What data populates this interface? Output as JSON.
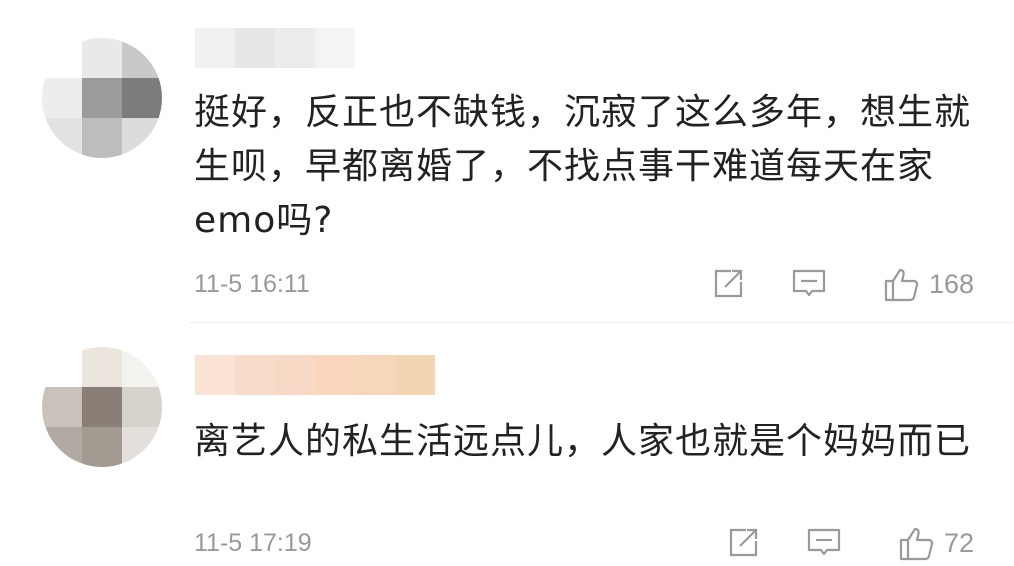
{
  "comments": [
    {
      "text": "挺好，反正也不缺钱，沉寂了这么多年，想生就生呗，早都离婚了，不找点事干难道每天在家emo吗?",
      "time": "11-5 16:11",
      "like_count": "168",
      "avatar_colors": [
        "#ffffff",
        "#e9e9e9",
        "#c9c9c9",
        "#ededed",
        "#9b9b9b",
        "#7c7c7c",
        "#e2e2e2",
        "#bdbdbd",
        "#dcdcdc"
      ],
      "username_colors": [
        "#f1f1f1",
        "#e7e7e7",
        "#ececec",
        "#f4f4f4"
      ]
    },
    {
      "text": "离艺人的私生活远点儿，人家也就是个妈妈而已",
      "time": "11-5 17:19",
      "like_count": "72",
      "avatar_colors": [
        "#ffffff",
        "#ebe5de",
        "#f4f2ee",
        "#c9c2bb",
        "#8a7f77",
        "#d8d2cc",
        "#b1aaa3",
        "#a39a92",
        "#e4dfda"
      ],
      "username_colors": [
        "#fbe4d6",
        "#f7dcc9",
        "#f7d9c5",
        "#f9d6bc",
        "#f6d7b9",
        "#f2d5b2"
      ]
    }
  ],
  "icons": {
    "share": "share-icon",
    "reply": "comment-icon",
    "like": "thumbs-up-icon"
  },
  "colors": {
    "meta_text": "#999999",
    "body_text": "#222222",
    "divider": "#ececec"
  }
}
